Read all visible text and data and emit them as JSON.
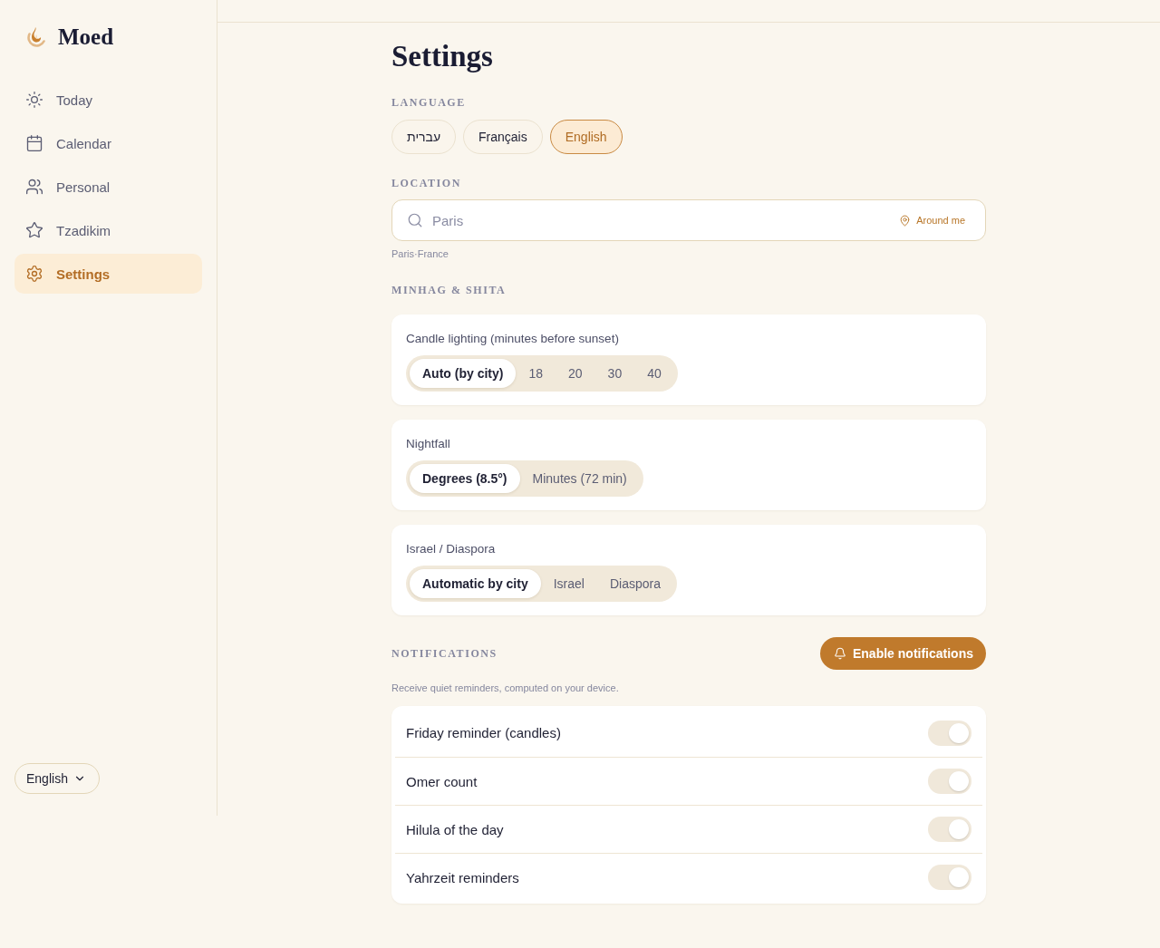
{
  "brand": {
    "name": "Moed"
  },
  "sidebar": {
    "items": [
      {
        "label": "Today",
        "selected": false
      },
      {
        "label": "Calendar",
        "selected": false
      },
      {
        "label": "Personal",
        "selected": false
      },
      {
        "label": "Tzadikim",
        "selected": false
      },
      {
        "label": "Settings",
        "selected": true
      }
    ],
    "language_select": {
      "value": "English"
    }
  },
  "page": {
    "title": "Settings"
  },
  "language": {
    "label": "LANGUAGE",
    "options": [
      {
        "label": "עברית",
        "selected": false
      },
      {
        "label": "Français",
        "selected": false
      },
      {
        "label": "English",
        "selected": true
      }
    ]
  },
  "location": {
    "label": "LOCATION",
    "search": {
      "placeholder": "Paris"
    },
    "locate_button": "Around me",
    "resolved": "Paris·France"
  },
  "minhag": {
    "label": "MINHAG & SHITA",
    "settings": [
      {
        "label": "Candle lighting (minutes before sunset)",
        "options": [
          {
            "label": "Auto (by city)",
            "selected": true
          },
          {
            "label": "18",
            "selected": false
          },
          {
            "label": "20",
            "selected": false
          },
          {
            "label": "30",
            "selected": false
          },
          {
            "label": "40",
            "selected": false
          }
        ]
      },
      {
        "label": "Nightfall",
        "options": [
          {
            "label": "Degrees (8.5°)",
            "selected": true
          },
          {
            "label": "Minutes (72 min)",
            "selected": false
          }
        ]
      },
      {
        "label": "Israel / Diaspora",
        "options": [
          {
            "label": "Automatic by city",
            "selected": true
          },
          {
            "label": "Israel",
            "selected": false
          },
          {
            "label": "Diaspora",
            "selected": false
          }
        ]
      }
    ]
  },
  "notifications": {
    "label": "NOTIFICATIONS",
    "enable_button": "Enable notifications",
    "description": "Receive quiet reminders, computed on your device.",
    "toggles": [
      {
        "label": "Friday reminder (candles)",
        "on": true,
        "disabled": true
      },
      {
        "label": "Omer count",
        "on": true,
        "disabled": true
      },
      {
        "label": "Hilula of the day",
        "on": true,
        "disabled": true
      },
      {
        "label": "Yahrzeit reminders",
        "on": true,
        "disabled": true
      }
    ]
  }
}
